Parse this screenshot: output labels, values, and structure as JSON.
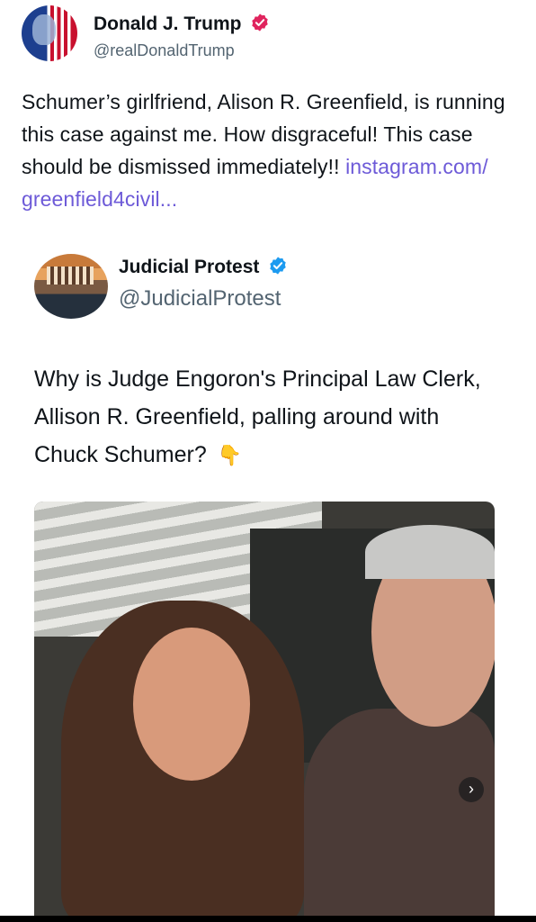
{
  "post": {
    "author_name": "Donald J. Trump",
    "author_handle": "@realDonaldTrump",
    "text": "Schumer’s girlfriend, Alison R. Greenfield, is running this case against me. How disgraceful! This case should be dismissed immediately!! ",
    "link_text": "instagram.com/ greenfield4civil...",
    "badge_color": "#e0245e",
    "link_color": "#6d5ad8"
  },
  "quote": {
    "author_name": "Judicial Protest",
    "author_handle": "@JudicialProtest",
    "text": "Why is Judge Engoron's Principal Law Clerk, Allison R. Greenfield, palling around with Chuck Schumer?",
    "emoji": "👇",
    "badge_color": "#1d9bf0"
  },
  "photo": {
    "next_label": "›"
  },
  "icons": [
    "verified-badge-icon",
    "pointing-down-icon",
    "chevron-right-icon"
  ]
}
